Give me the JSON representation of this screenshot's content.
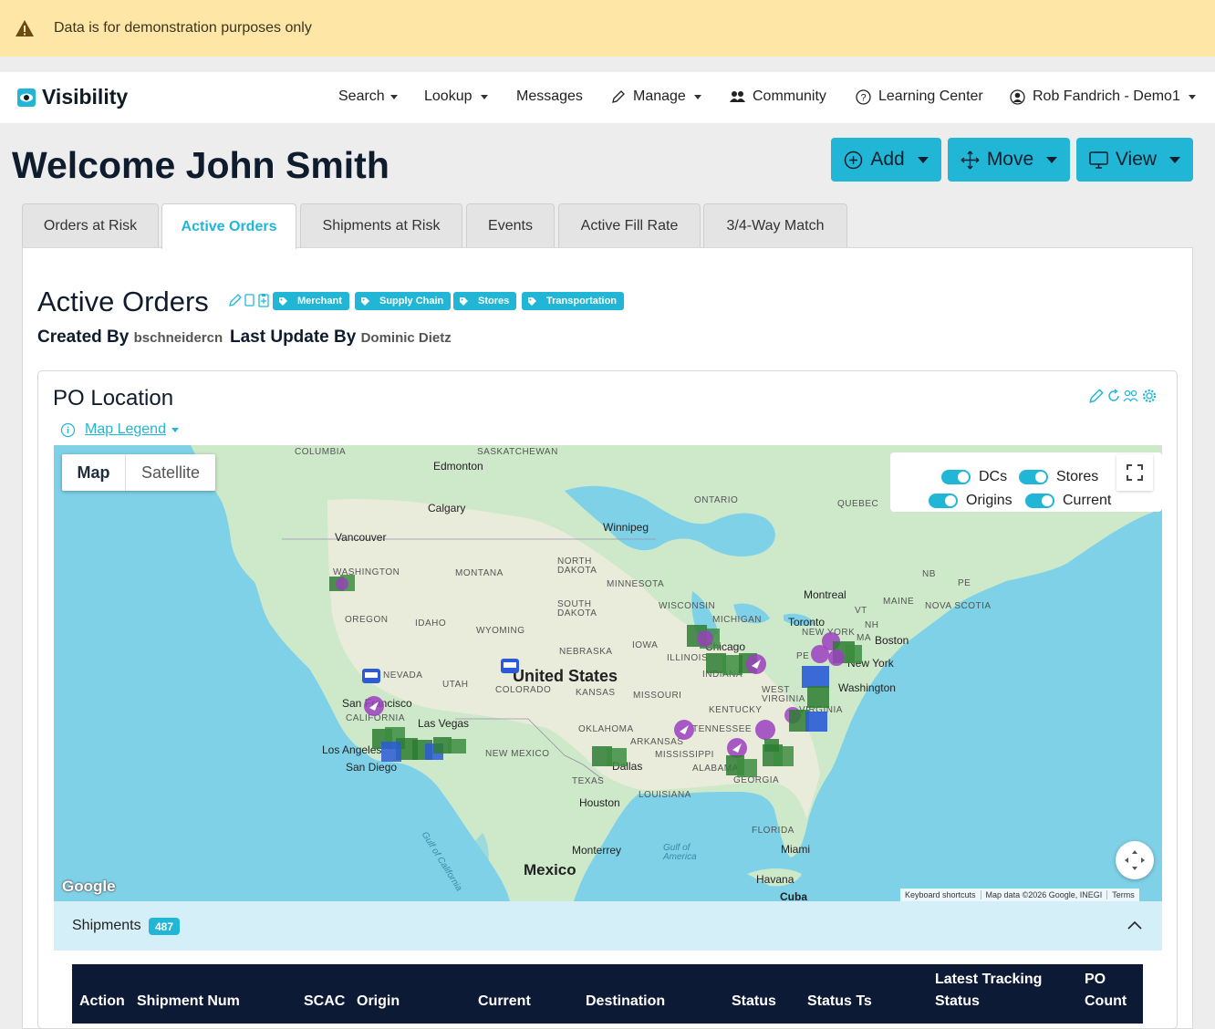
{
  "banner": {
    "text": "Data is for demonstration purposes only",
    "icon": "warning-triangle-icon"
  },
  "brand": {
    "name": "Visibility",
    "icon": "eye-logo-icon",
    "color": "#22b6d6"
  },
  "nav": {
    "search": "Search",
    "lookup": "Lookup",
    "messages": "Messages",
    "manage": "Manage",
    "community": "Community",
    "learning": "Learning Center",
    "user": "Rob Fandrich - Demo1"
  },
  "page": {
    "welcome": "Welcome John Smith"
  },
  "actions": {
    "add": "Add",
    "move": "Move",
    "view": "View"
  },
  "tabs": [
    {
      "label": "Orders at Risk",
      "active": false
    },
    {
      "label": "Active Orders",
      "active": true
    },
    {
      "label": "Shipments at Risk",
      "active": false
    },
    {
      "label": "Events",
      "active": false
    },
    {
      "label": "Active Fill Rate",
      "active": false
    },
    {
      "label": "3/4-Way Match",
      "active": false
    }
  ],
  "dashboard": {
    "title": "Active Orders",
    "tags": [
      "Merchant",
      "Supply Chain",
      "Stores",
      "Transportation"
    ],
    "created_by_label": "Created By",
    "created_by": "bschneidercn",
    "last_update_label": "Last Update By",
    "last_update": "Dominic Dietz"
  },
  "widget": {
    "title": "PO Location",
    "legend_link": "Map Legend"
  },
  "map": {
    "type_options": [
      "Map",
      "Satellite"
    ],
    "selected_type": "Map",
    "toggles": {
      "dcs": "DCs",
      "stores": "Stores",
      "origins": "Origins",
      "current": "Current"
    },
    "google": "Google",
    "attribution": [
      "Keyboard shortcuts",
      "Map data ©2026 Google, INEGI",
      "Terms"
    ],
    "labels": {
      "bc": "COLUMBIA",
      "sask": "SASKATCHEWAN",
      "edmonton": "Edmonton",
      "calgary": "Calgary",
      "vancouver": "Vancouver",
      "ontario": "ONTARIO",
      "quebec": "QUEBEC",
      "winnipeg": "Winnipeg",
      "washington": "WASHINGTON",
      "montana": "MONTANA",
      "nd": "NORTH\nDAKOTA",
      "minnesota": "MINNESOTA",
      "oregon": "OREGON",
      "idaho": "IDAHO",
      "sd": "SOUTH\nDAKOTA",
      "wisconsin": "WISCONSIN",
      "michigan": "MICHIGAN",
      "wyoming": "WYOMING",
      "nevada": "NEVADA",
      "utah": "UTAH",
      "nebraska": "NEBRASKA",
      "iowa": "IOWA",
      "illinois": "ILLINOIS",
      "us": "United States",
      "colorado": "COLORADO",
      "kansas": "KANSAS",
      "missouri": "MISSOURI",
      "sf": "San Francisco",
      "california": "CALIFORNIA",
      "lasvegas": "Las Vegas",
      "la": "Los Angeles",
      "sandiego": "San Diego",
      "oklahoma": "OKLAHOMA",
      "arkansas": "ARKANSAS",
      "newmexico": "NEW MEXICO",
      "texas": "TEXAS",
      "dallas": "Dallas",
      "houston": "Houston",
      "louisiana": "LOUISIANA",
      "mississippi": "MISSISSIPPI",
      "alabama": "ALABAMA",
      "georgia": "GEORGIA",
      "tennessee": "TENNESSEE",
      "kentucky": "KENTUCKY",
      "westvirginia": "WEST\nVIRGINIA",
      "virginia": "VIRGINIA",
      "washingtondc": "Washington",
      "newyork": "New York",
      "ny": "NEW YORK",
      "toronto": "Toronto",
      "montreal": "Montreal",
      "boston": "Boston",
      "maine": "MAINE",
      "vt": "VT",
      "nh": "NH",
      "ma": "MA",
      "nb": "NB",
      "pe": "PE",
      "novascotia": "NOVA SCOTIA",
      "florida": "FLORIDA",
      "miami": "Miami",
      "monterrey": "Monterrey",
      "mexico": "Mexico",
      "havana": "Havana",
      "cuba": "Cuba",
      "gulfmexico": "Gulf of\nAmerica",
      "gulfcal": "Gulf of California",
      "chicago": "Chicago",
      "indiana": "INDIANA",
      "pa": "PE"
    }
  },
  "shipments": {
    "label": "Shipments",
    "count": "487",
    "columns": [
      "Action",
      "Shipment Num",
      "SCAC",
      "Origin",
      "Current",
      "Destination",
      "Status",
      "Status Ts",
      "Latest Tracking Status",
      "PO Count"
    ]
  },
  "colors": {
    "accent": "#22b6d6",
    "table_header": "#0d1a36",
    "banner": "#fde6a6",
    "marker_dc": "#2e7d32",
    "marker_store": "#2b5bd7",
    "marker_current": "#9b3fbf"
  }
}
